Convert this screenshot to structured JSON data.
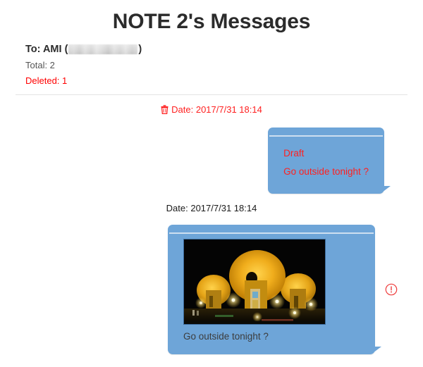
{
  "page": {
    "title": "NOTE 2's Messages"
  },
  "meta": {
    "to_label": "To: AMI (",
    "to_close": ")",
    "recipient_name": "AMI",
    "recipient_number_redacted": "redacted-blur-block",
    "total_label": "Total: 2",
    "deleted_label": "Deleted: 1",
    "deleted_color": "#ff0000"
  },
  "theme": {
    "bubble_color": "#6ea5d8",
    "bubble_highlight": "#cddff0",
    "draft_text_color": "#ff2020",
    "normal_text_color": "#3c3c3c",
    "warning_color": "#ee3b3b"
  },
  "messages": [
    {
      "date": "Date: 2017/7/31 18:14",
      "is_deleted": true,
      "delete_icon": "trash-icon",
      "lines": [
        "Draft",
        "Go outside tonight ?"
      ],
      "has_photo": false,
      "has_warning": false
    },
    {
      "date": "Date: 2017/7/31 18:14",
      "is_deleted": false,
      "lines": [
        "Go outside tonight ?"
      ],
      "has_photo": true,
      "photo_alt": "night photo of illuminated golden dome structures",
      "has_warning": true,
      "warning_icon": "exclamation-circle-icon"
    }
  ]
}
